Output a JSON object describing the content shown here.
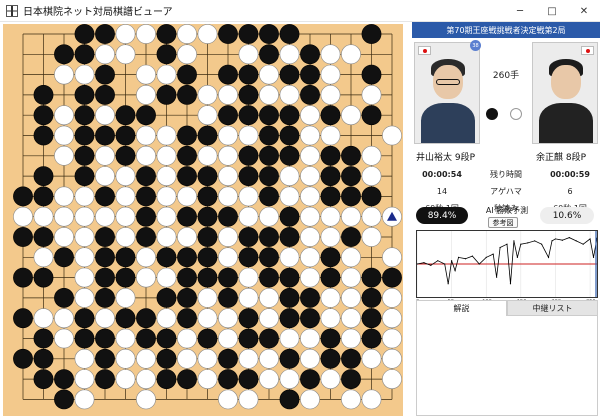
{
  "window": {
    "title": "日本棋院ネット対局棋譜ビューア",
    "icon": "go-board-icon",
    "minimize_label": "─",
    "maximize_label": "□",
    "close_label": "✕"
  },
  "board": {
    "size": 19,
    "board_color": "#f3c98c",
    "last_move_marker": "triangle",
    "stones": [
      "...BBWWBWWBBBB...B.",
      "..BBWW.BW..WBWBWW..",
      "..WWB.WWB.BBWBBW.B.",
      ".B.BB.WBBWWBWWBW.W.",
      ".BWBWBB..WBBBBWBWB.",
      ".BWBBBWWBBWWBBWW..W",
      "..WBWBWWBWWBBBWBBW.",
      ".B.BWWBWBBWBBWWBBW.",
      "BBWWBWBWWBWWBWWBBB.",
      "WWWWWWBWBBBWWBWWWWW",
      "BBWWBWBWWBWBBBWWBW.",
      ".WBWBBWBBBWBBWWBW.W",
      "BB.WBBWWBBBWBBWBWBB",
      "..BWBW.BBWBWWBBWWBW",
      "BWWBWBBWBWWBWBBWWBW",
      ".BWBBWBBWBWBBWWBWBW",
      "BB.WBWWBWWBWWBWBBWW",
      ".BBWBWWBBWBBWWBWB.W",
      "..BW..W...WW.BW.WW."
    ]
  },
  "match": {
    "title": "第70期王座戦挑戦者決定戦第2局",
    "move_count": "260手",
    "move_badge": "38",
    "black_player": {
      "name": "井山裕太",
      "rank": "9段P",
      "flag": "japan-flag-icon"
    },
    "white_player": {
      "name": "余正麒",
      "rank": "8段P",
      "flag": "japan-flag-icon"
    },
    "rows": [
      {
        "left": "00:00:54",
        "label": "残り時間",
        "right": "00:00:59"
      },
      {
        "left": "14",
        "label": "アゲハマ",
        "right": "6"
      },
      {
        "left": "60秒 1回",
        "label": "秒読み",
        "right": "60秒 1回"
      }
    ]
  },
  "ai": {
    "label": "AI 勝敗予測",
    "black_pct": "89.4%",
    "white_pct": "10.6%",
    "reference_button": "参考図"
  },
  "chart_data": {
    "type": "line",
    "title": "",
    "xlabel": "",
    "ylabel": "",
    "x_ticks": [
      "0",
      "50",
      "100",
      "150",
      "200",
      "250"
    ],
    "xlim": [
      0,
      260
    ],
    "ylim": [
      0,
      100
    ],
    "series": [
      {
        "color": "#000000",
        "x": [
          0,
          10,
          20,
          30,
          40,
          45,
          50,
          55,
          60,
          70,
          80,
          90,
          100,
          110,
          115,
          120,
          130,
          135,
          140,
          145,
          150,
          160,
          170,
          180,
          190,
          195,
          200,
          210,
          220,
          230,
          240,
          250,
          255,
          260
        ],
        "values": [
          50,
          52,
          48,
          55,
          50,
          20,
          55,
          40,
          60,
          58,
          62,
          50,
          60,
          65,
          30,
          75,
          80,
          20,
          85,
          60,
          80,
          82,
          85,
          80,
          60,
          85,
          88,
          86,
          90,
          85,
          80,
          88,
          60,
          89
        ]
      }
    ],
    "reference_line": {
      "value": 50,
      "color": "#cc2222"
    }
  },
  "tabs": [
    {
      "label": "解説",
      "active": true
    },
    {
      "label": "中継リスト",
      "active": false
    }
  ],
  "colors": {
    "header_blue": "#2b5aa9",
    "accent_red": "#cc2222"
  }
}
